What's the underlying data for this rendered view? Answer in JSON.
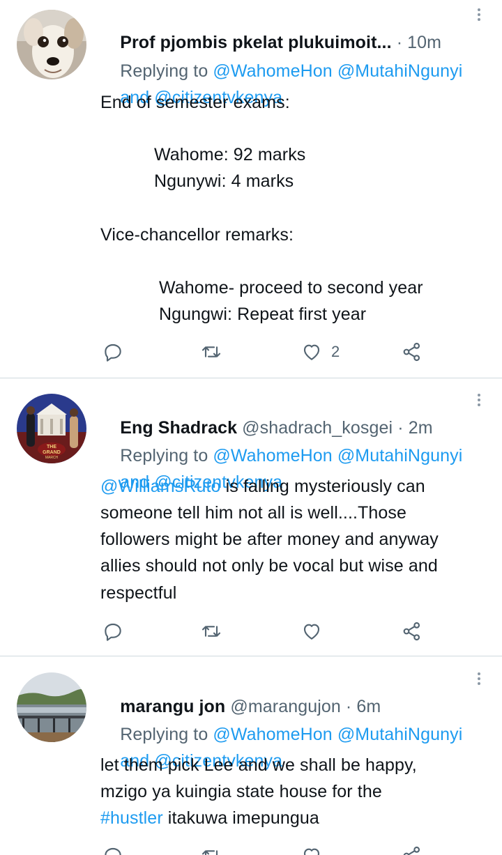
{
  "tweets": [
    {
      "display_name": "Prof pjombis pkelat plukuimoit...",
      "handle": "",
      "time": "· 10m",
      "replying_prefix": "Replying to",
      "mentions_line1": "@WahomeHon @MutahiNgunyi",
      "and_word": "and",
      "mentions_line2": "@citizentvkenya",
      "body": {
        "l1": "End of semester exams:",
        "l2": "Wahome: 92 marks",
        "l3": "Ngunywi: 4 marks",
        "l4": "Vice-chancellor remarks:",
        "l5": "Wahome- proceed to second year",
        "l6": "Ngungwi: Repeat first year"
      },
      "like_count": "2"
    },
    {
      "display_name": "Eng Shadrack",
      "handle": "@shadrach_kosgei",
      "time": "· 2m",
      "replying_prefix": "Replying to",
      "mentions_line1": "@WahomeHon @MutahiNgunyi",
      "and_word": "and",
      "mentions_line2": "@citizentvkenya",
      "body": {
        "mention": "@WilliamsRuto",
        "l1_rest": " is falling mysteriously can",
        "l2": "someone tell him not all is well....Those",
        "l3": "followers might be after money and anyway",
        "l4": "allies should not only be vocal but wise and",
        "l5": "respectful"
      },
      "avatar_text": "THE GRAND MARCH",
      "like_count": ""
    },
    {
      "display_name": "marangu jon",
      "handle": "@marangujon",
      "time": "· 6m",
      "replying_prefix": "Replying to",
      "mentions_line1": "@WahomeHon @MutahiNgunyi",
      "and_word": "and",
      "mentions_line2": "@citizentvkenya",
      "body": {
        "l1": "let them pick Lee and we shall be happy,",
        "l2": "mzigo ya kuingia state house for the",
        "hashtag": "#hustler",
        "l3_rest": " itakuwa imepungua"
      },
      "like_count": ""
    }
  ],
  "icons": {
    "reply": "reply-icon",
    "retweet": "retweet-icon",
    "like": "heart-icon",
    "share": "share-icon",
    "more": "more-options-icon"
  },
  "colors": {
    "link": "#1d9bf0",
    "muted": "#536471",
    "text": "#0f1419",
    "divider": "#cfd9de"
  }
}
